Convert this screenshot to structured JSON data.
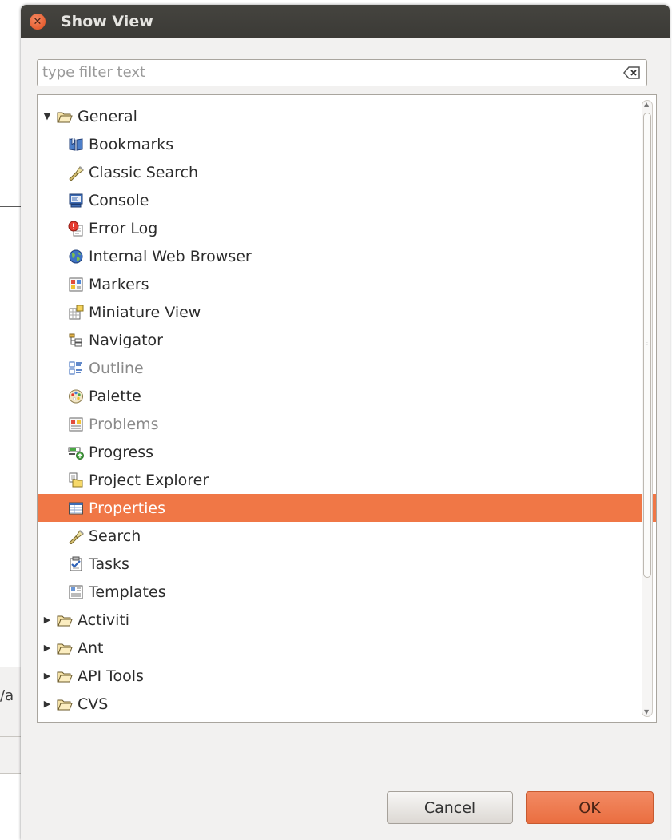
{
  "dialog": {
    "title": "Show View",
    "filter_placeholder": "type filter text",
    "cancel_label": "Cancel",
    "ok_label": "OK"
  },
  "background": {
    "fragment_text": "/a"
  },
  "tree": {
    "items": [
      {
        "label": "General",
        "level": 0,
        "type": "folder",
        "expanded": true,
        "icon": "folder-open-icon"
      },
      {
        "label": "Bookmarks",
        "level": 1,
        "type": "view",
        "icon": "bookmarks-icon"
      },
      {
        "label": "Classic Search",
        "level": 1,
        "type": "view",
        "icon": "search-flashlight-icon"
      },
      {
        "label": "Console",
        "level": 1,
        "type": "view",
        "icon": "console-icon"
      },
      {
        "label": "Error Log",
        "level": 1,
        "type": "view",
        "icon": "error-log-icon"
      },
      {
        "label": "Internal Web Browser",
        "level": 1,
        "type": "view",
        "icon": "globe-icon"
      },
      {
        "label": "Markers",
        "level": 1,
        "type": "view",
        "icon": "markers-icon"
      },
      {
        "label": "Miniature View",
        "level": 1,
        "type": "view",
        "icon": "miniature-view-icon"
      },
      {
        "label": "Navigator",
        "level": 1,
        "type": "view",
        "icon": "navigator-icon"
      },
      {
        "label": "Outline",
        "level": 1,
        "type": "view",
        "icon": "outline-icon",
        "disabled": true
      },
      {
        "label": "Palette",
        "level": 1,
        "type": "view",
        "icon": "palette-icon"
      },
      {
        "label": "Problems",
        "level": 1,
        "type": "view",
        "icon": "problems-icon",
        "disabled": true
      },
      {
        "label": "Progress",
        "level": 1,
        "type": "view",
        "icon": "progress-icon"
      },
      {
        "label": "Project Explorer",
        "level": 1,
        "type": "view",
        "icon": "project-explorer-icon"
      },
      {
        "label": "Properties",
        "level": 1,
        "type": "view",
        "icon": "properties-icon",
        "selected": true
      },
      {
        "label": "Search",
        "level": 1,
        "type": "view",
        "icon": "search-flashlight-icon"
      },
      {
        "label": "Tasks",
        "level": 1,
        "type": "view",
        "icon": "tasks-icon"
      },
      {
        "label": "Templates",
        "level": 1,
        "type": "view",
        "icon": "templates-icon"
      },
      {
        "label": "Activiti",
        "level": 0,
        "type": "folder",
        "expanded": false,
        "icon": "folder-icon"
      },
      {
        "label": "Ant",
        "level": 0,
        "type": "folder",
        "expanded": false,
        "icon": "folder-icon"
      },
      {
        "label": "API Tools",
        "level": 0,
        "type": "folder",
        "expanded": false,
        "icon": "folder-icon"
      },
      {
        "label": "CVS",
        "level": 0,
        "type": "folder",
        "expanded": false,
        "icon": "folder-icon"
      }
    ]
  },
  "colors": {
    "titlebar": "#3c3b37",
    "selection": "#f07746",
    "dialog_bg": "#f2f1f0",
    "ok_button": "#ee7b4f"
  }
}
